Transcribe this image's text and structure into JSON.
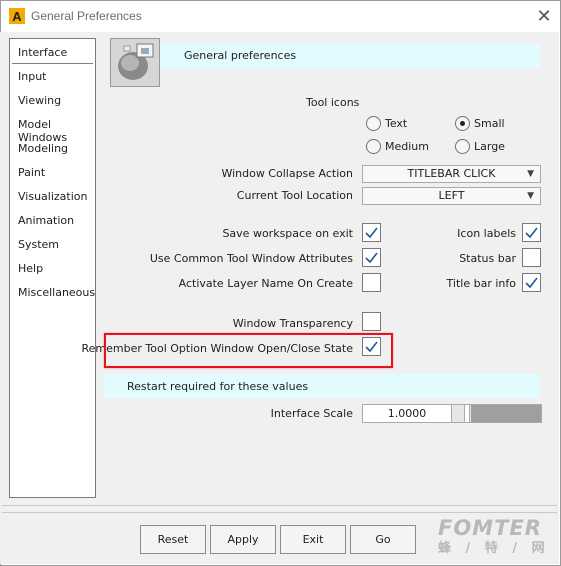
{
  "window": {
    "title": "General Preferences",
    "close_symbol": "✕",
    "app_glyph": "A"
  },
  "sidebar": {
    "items": [
      {
        "label": "Interface"
      },
      {
        "label": "Input"
      },
      {
        "label": "Viewing"
      },
      {
        "label": "Model Windows"
      },
      {
        "label": "Modeling"
      },
      {
        "label": "Paint"
      },
      {
        "label": "Visualization"
      },
      {
        "label": "Animation"
      },
      {
        "label": "System"
      },
      {
        "label": "Help"
      },
      {
        "label": "Miscellaneous"
      }
    ]
  },
  "header": {
    "title": "General preferences"
  },
  "tool_icons": {
    "label": "Tool icons",
    "options": {
      "text": {
        "label": "Text",
        "selected": false
      },
      "small": {
        "label": "Small",
        "selected": true
      },
      "medium": {
        "label": "Medium",
        "selected": false
      },
      "large": {
        "label": "Large",
        "selected": false
      }
    }
  },
  "window_collapse": {
    "label": "Window Collapse Action",
    "value": "TITLEBAR CLICK"
  },
  "current_tool_location": {
    "label": "Current Tool Location",
    "value": "LEFT"
  },
  "checkboxes": {
    "save_workspace": {
      "label": "Save workspace on exit",
      "checked": true
    },
    "use_common_tool_window": {
      "label": "Use Common Tool Window Attributes",
      "checked": true
    },
    "activate_layer_name": {
      "label": "Activate Layer Name On Create",
      "checked": false
    },
    "icon_labels": {
      "label": "Icon labels",
      "checked": true
    },
    "status_bar": {
      "label": "Status bar",
      "checked": false
    },
    "title_bar_info": {
      "label": "Title bar info",
      "checked": true
    },
    "window_transparency": {
      "label": "Window Transparency",
      "checked": false
    },
    "remember_tool_option": {
      "label": "Remember Tool Option Window Open/Close State",
      "checked": true
    }
  },
  "restart": {
    "label": "Restart required for these values"
  },
  "interface_scale": {
    "label": "Interface Scale",
    "value": "1.0000"
  },
  "buttons": {
    "reset": "Reset",
    "apply": "Apply",
    "exit": "Exit",
    "go": "Go"
  },
  "watermark": {
    "brand": "FOMTER",
    "sub": "蜂 / 特 / 网"
  },
  "colors": {
    "header_band": "#e1fbff",
    "highlight": "#e6131b",
    "slider_fill": "#9f9f9f"
  },
  "symbols": {
    "check": "✓",
    "caret": "▼"
  }
}
